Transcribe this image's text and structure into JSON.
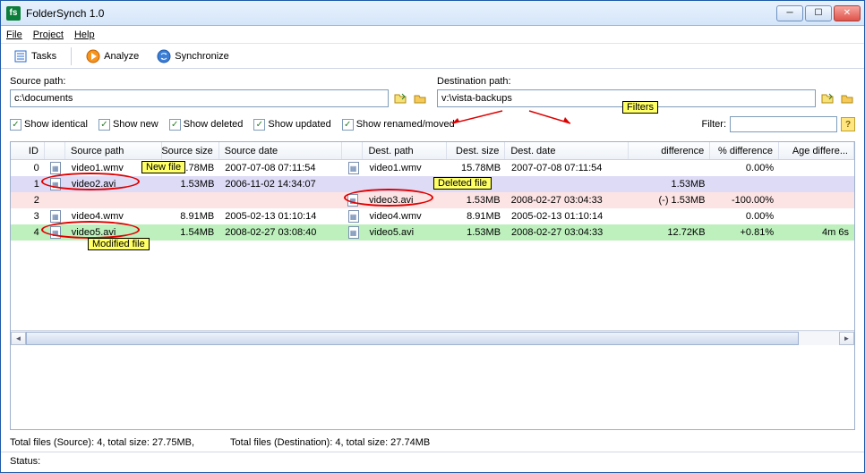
{
  "window": {
    "title": "FolderSynch 1.0",
    "icon_text": "fs"
  },
  "menubar": {
    "file": "File",
    "project": "Project",
    "help": "Help"
  },
  "toolbar": {
    "tasks": "Tasks",
    "analyze": "Analyze",
    "synchronize": "Synchronize"
  },
  "paths": {
    "source_label": "Source path:",
    "dest_label": "Destination path:",
    "source_value": "c:\\documents",
    "dest_value": "v:\\vista-backups"
  },
  "filters": {
    "show_identical": "Show identical",
    "show_new": "Show new",
    "show_deleted": "Show deleted",
    "show_updated": "Show updated",
    "show_renamed": "Show renamed/moved",
    "filter_label": "Filter:",
    "filter_value": ""
  },
  "annotations": {
    "filters": "Filters",
    "new_file": "New file",
    "deleted_file": "Deleted file",
    "modified_file": "Modified file"
  },
  "columns": {
    "id": "ID",
    "spath": "Source path",
    "ssize": "Source size",
    "sdate": "Source date",
    "dpath": "Dest. path",
    "dsize": "Dest. size",
    "ddate": "Dest. date",
    "diff": "difference",
    "pct": "% difference",
    "age": "Age differe..."
  },
  "rows": [
    {
      "id": "0",
      "spath": "video1.wmv",
      "ssize": "15.78MB",
      "sdate": "2007-07-08 07:11:54",
      "dpath": "video1.wmv",
      "dsize": "15.78MB",
      "ddate": "2007-07-08 07:11:54",
      "diff": "",
      "pct": "0.00%",
      "age": "",
      "cls": "row-white",
      "sico": true,
      "dico": true
    },
    {
      "id": "1",
      "spath": "video2.avi",
      "ssize": "1.53MB",
      "sdate": "2006-11-02 14:34:07",
      "dpath": "",
      "dsize": "",
      "ddate": "",
      "diff": "1.53MB",
      "pct": "",
      "age": "",
      "cls": "row-lav",
      "sico": true,
      "dico": false
    },
    {
      "id": "2",
      "spath": "",
      "ssize": "",
      "sdate": "",
      "dpath": "video3.avi",
      "dsize": "1.53MB",
      "ddate": "2008-02-27 03:04:33",
      "diff": "(-) 1.53MB",
      "pct": "-100.00%",
      "age": "",
      "cls": "row-pink",
      "sico": false,
      "dico": true
    },
    {
      "id": "3",
      "spath": "video4.wmv",
      "ssize": "8.91MB",
      "sdate": "2005-02-13 01:10:14",
      "dpath": "video4.wmv",
      "dsize": "8.91MB",
      "ddate": "2005-02-13 01:10:14",
      "diff": "",
      "pct": "0.00%",
      "age": "",
      "cls": "row-white",
      "sico": true,
      "dico": true
    },
    {
      "id": "4",
      "spath": "video5.avi",
      "ssize": "1.54MB",
      "sdate": "2008-02-27 03:08:40",
      "dpath": "video5.avi",
      "dsize": "1.53MB",
      "ddate": "2008-02-27 03:04:33",
      "diff": "12.72KB",
      "pct": "+0.81%",
      "age": "4m 6s",
      "cls": "row-green",
      "sico": true,
      "dico": true
    }
  ],
  "footer": {
    "source_totals": "Total files (Source): 4, total size: 27.75MB,",
    "dest_totals": "Total files (Destination): 4, total size: 27.74MB"
  },
  "status": {
    "label": "Status:"
  }
}
